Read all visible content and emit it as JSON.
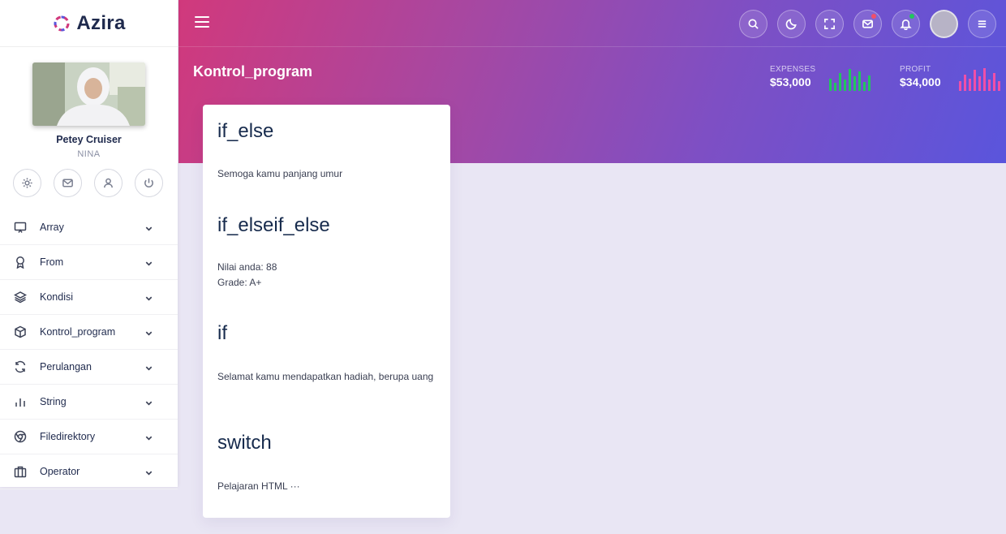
{
  "brand": {
    "name": "Azira"
  },
  "profile": {
    "name": "Petey Cruiser",
    "role": "NINA"
  },
  "profile_actions": [
    "gear-icon",
    "mail-icon",
    "user-icon",
    "power-icon"
  ],
  "sidebar": {
    "items": [
      {
        "label": "Array",
        "icon": "monitor-icon"
      },
      {
        "label": "From",
        "icon": "award-icon"
      },
      {
        "label": "Kondisi",
        "icon": "layers-icon"
      },
      {
        "label": "Kontrol_program",
        "icon": "box-icon"
      },
      {
        "label": "Perulangan",
        "icon": "refresh-icon"
      },
      {
        "label": "String",
        "icon": "bar-chart-icon"
      },
      {
        "label": "Filedirektory",
        "icon": "chrome-icon"
      },
      {
        "label": "Operator",
        "icon": "briefcase-icon"
      }
    ]
  },
  "header": {
    "title": "Kontrol_program",
    "icons": [
      "search-icon",
      "moon-icon",
      "fullscreen-icon",
      "mail-icon",
      "bell-icon",
      "avatar",
      "menu-icon"
    ],
    "stats": [
      {
        "label": "EXPENSES",
        "value": "$53,000",
        "color": "#22c55e"
      },
      {
        "label": "PROFIT",
        "value": "$34,000",
        "color": "#f04fa8"
      }
    ]
  },
  "content": {
    "sections": [
      {
        "heading": "if_else",
        "text": "Semoga kamu panjang umur"
      },
      {
        "heading": "if_elseif_else",
        "text_lines": [
          "Nilai anda: 88",
          "Grade: A+"
        ]
      },
      {
        "heading": "if",
        "text": "Selamat kamu mendapatkan hadiah, berupa uang"
      },
      {
        "heading": "switch",
        "text": "Pelajaran HTML ···"
      }
    ]
  },
  "colors": {
    "accent_pink": "#d1397c",
    "accent_blue": "#5a55dc",
    "background": "#e9e6f4"
  }
}
